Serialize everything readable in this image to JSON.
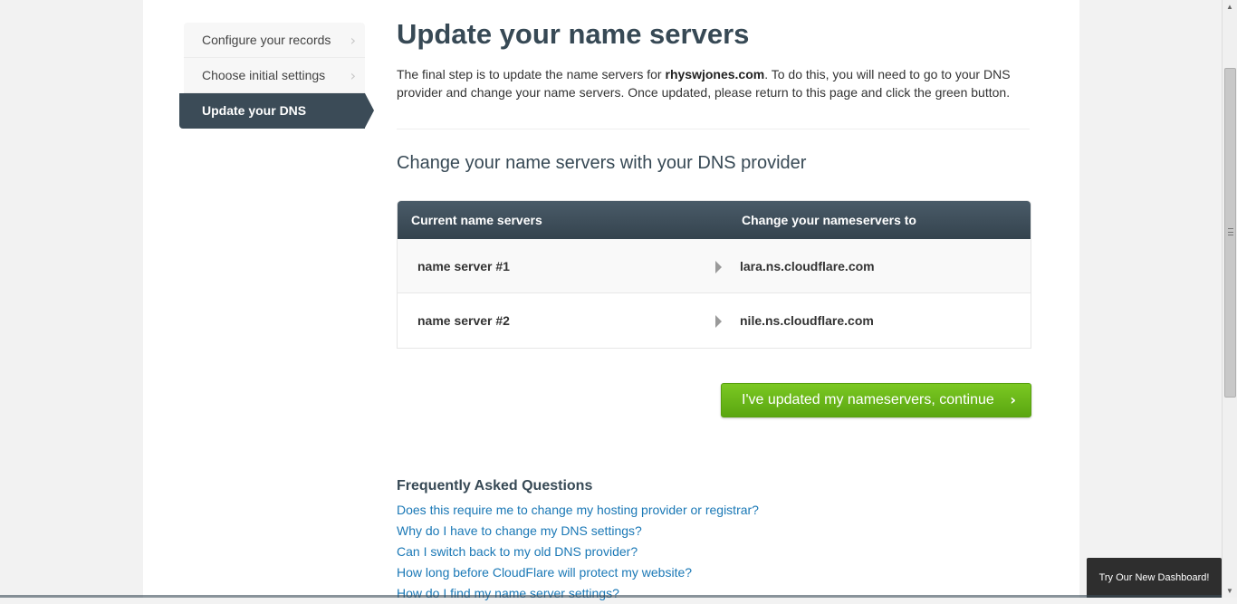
{
  "steps": [
    {
      "label": "Configure your records"
    },
    {
      "label": "Choose initial settings"
    },
    {
      "label": "Update your DNS"
    }
  ],
  "main": {
    "title": "Update your name servers",
    "intro_pre": "The final step is to update the name servers for ",
    "domain": "rhyswjones.com",
    "intro_post": ". To do this, you will need to go to your DNS provider and change your name servers. Once updated, please return to this page and click the green button.",
    "subtitle": "Change your name servers with your DNS provider"
  },
  "table": {
    "header_current": "Current name servers",
    "header_new": "Change your nameservers to",
    "rows": [
      {
        "current": "name server #1",
        "new": "lara.ns.cloudflare.com"
      },
      {
        "current": "name server #2",
        "new": "nile.ns.cloudflare.com"
      }
    ]
  },
  "continue_label": "I've updated my nameservers, continue",
  "faq": {
    "title": "Frequently Asked Questions",
    "links": [
      "Does this require me to change my hosting provider or registrar?",
      "Why do I have to change my DNS settings?",
      "Can I switch back to my old DNS provider?",
      "How long before CloudFlare will protect my website?",
      "How do I find my name server settings?"
    ]
  },
  "try_dashboard_label": "Try Our New Dashboard!",
  "colors": {
    "accent_dark": "#3b4b57",
    "button_green": "#6cb71a",
    "link_blue": "#1a78b6"
  }
}
